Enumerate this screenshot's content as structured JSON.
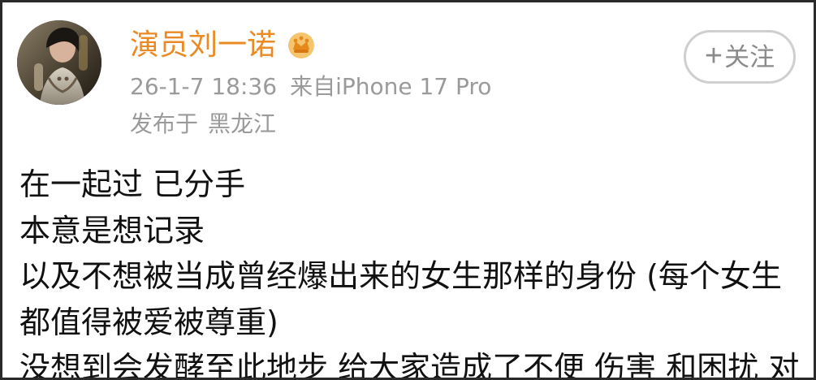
{
  "post": {
    "author": {
      "name": "演员刘一诺",
      "badge_icon": "crown-icon",
      "avatar_icon": "avatar-photo"
    },
    "follow_button": {
      "icon": "plus-icon",
      "label": "关注"
    },
    "meta": {
      "datetime": "26-1-7 18:36",
      "source": "来自iPhone 17 Pro",
      "location_prefix": "发布于",
      "location": "黑龙江"
    },
    "content_lines": [
      "在一起过 已分手",
      "本意是想记录",
      "以及不想被当成曾经爆出来的女生那样的身份 (每个女生",
      "都值得被爱被尊重)",
      "没想到会发酵至此地步 给大家造成了不便 伤害 和困扰 对"
    ]
  },
  "colors": {
    "username": "#e98a24",
    "meta_text": "#9a9a9a",
    "body_text": "#111111",
    "button_border": "#cfcfcf",
    "button_text": "#8b8b8b",
    "frame_border": "#2a2a2a"
  }
}
